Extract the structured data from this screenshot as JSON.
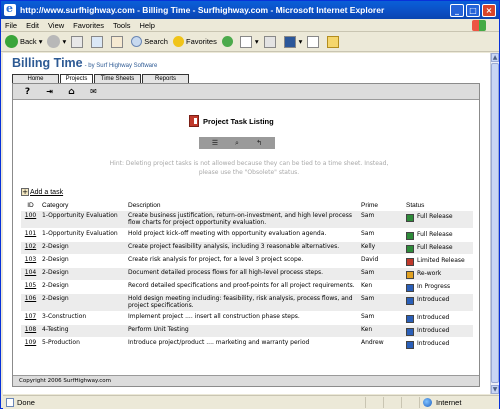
{
  "window": {
    "title": "http://www.surfhighway.com - Billing Time - Surfhighway.com - Microsoft Internet Explorer"
  },
  "menu": [
    "File",
    "Edit",
    "View",
    "Favorites",
    "Tools",
    "Help"
  ],
  "toolbar": {
    "back": "Back",
    "search": "Search",
    "favorites": "Favorites"
  },
  "app": {
    "title": "Billing Time",
    "by": "- by Surf Highway Software"
  },
  "tabs": [
    {
      "label": "Home"
    },
    {
      "label": "Projects",
      "active": true
    },
    {
      "label": "Time Sheets"
    },
    {
      "label": "Reports"
    }
  ],
  "icon_strip": [
    "help-icon",
    "exit-icon",
    "home-icon",
    "mail-icon"
  ],
  "listing": {
    "title": "Project Task Listing",
    "actions": [
      "list-icon",
      "magnifier-icon",
      "return-icon"
    ],
    "hint": "Hint: Deleting project tasks is not allowed because they can be tied to a time sheet. Instead, please use the \"Obsolete\" status."
  },
  "add_task_label": "Add a task",
  "table": {
    "headers": {
      "id": "ID",
      "category": "Category",
      "description": "Description",
      "prime": "Prime",
      "status": "Status"
    },
    "rows": [
      {
        "id": "100",
        "category": "1-Opportunity Evaluation",
        "description": "Create business justification, return-on-investment, and high level process flow charts for project opportunity evaluation.",
        "prime": "Sam",
        "status": "Full Release",
        "status_color": "#2e8b3a"
      },
      {
        "id": "101",
        "category": "1-Opportunity Evaluation",
        "description": "Hold project kick-off meeting with opportunity evaluation agenda.",
        "prime": "Sam",
        "status": "Full Release",
        "status_color": "#2e8b3a"
      },
      {
        "id": "102",
        "category": "2-Design",
        "description": "Create project feasibility analysis, including 3 reasonable alternatives.",
        "prime": "Kelly",
        "status": "Full Release",
        "status_color": "#2e8b3a"
      },
      {
        "id": "103",
        "category": "2-Design",
        "description": "Create risk analysis for project, for a level 3 project scope.",
        "prime": "David",
        "status": "Limited Release",
        "status_color": "#c0392b"
      },
      {
        "id": "104",
        "category": "2-Design",
        "description": "Document detailed process flows for all high-level process steps.",
        "prime": "Sam",
        "status": "Re-work",
        "status_color": "#e0a020"
      },
      {
        "id": "105",
        "category": "2-Design",
        "description": "Record detailed specifications and proof-points for all project requirements.",
        "prime": "Ken",
        "status": "In Progress",
        "status_color": "#2a5fb8"
      },
      {
        "id": "106",
        "category": "2-Design",
        "description": "Hold design meeting including: feasibility, risk analysis, process flows, and project specifications.",
        "prime": "Sam",
        "status": "Introduced",
        "status_color": "#2a5fb8"
      },
      {
        "id": "107",
        "category": "3-Construction",
        "description": "Implement project .... insert all construction phase steps.",
        "prime": "Sam",
        "status": "Introduced",
        "status_color": "#2a5fb8"
      },
      {
        "id": "108",
        "category": "4-Testing",
        "description": "Perform Unit Testing",
        "prime": "Ken",
        "status": "Introduced",
        "status_color": "#2a5fb8"
      },
      {
        "id": "109",
        "category": "5-Production",
        "description": "Introduce project/product .... marketing and warranty period",
        "prime": "Andrew",
        "status": "Introduced",
        "status_color": "#2a5fb8"
      }
    ]
  },
  "copyright": "Copyright 2006 SurfHighway.com",
  "statusbar": {
    "done": "Done",
    "zone": "Internet"
  }
}
